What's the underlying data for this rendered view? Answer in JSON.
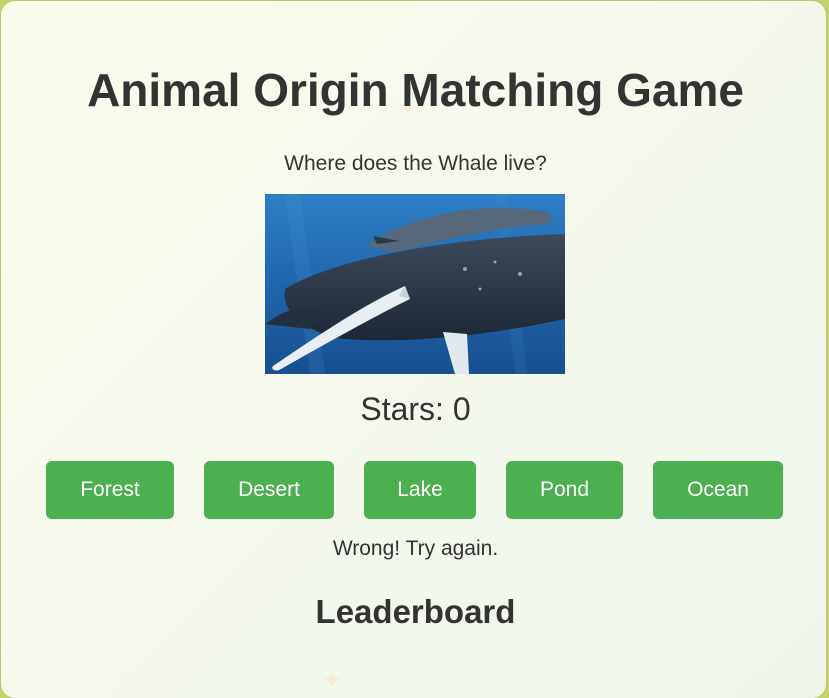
{
  "game": {
    "title": "Animal Origin Matching Game",
    "question": "Where does the Whale live?",
    "image_subject": "whale-image",
    "stars_label": "Stars: 0",
    "stars": 0,
    "choices": [
      "Forest",
      "Desert",
      "Lake",
      "Pond",
      "Ocean"
    ],
    "feedback": "Wrong! Try again.",
    "leaderboard_title": "Leaderboard"
  },
  "colors": {
    "button_bg": "#4caf50",
    "button_text": "#ffffff",
    "text": "#333333",
    "card_bg": "#f5f9ec",
    "border": "#c6d36a"
  }
}
